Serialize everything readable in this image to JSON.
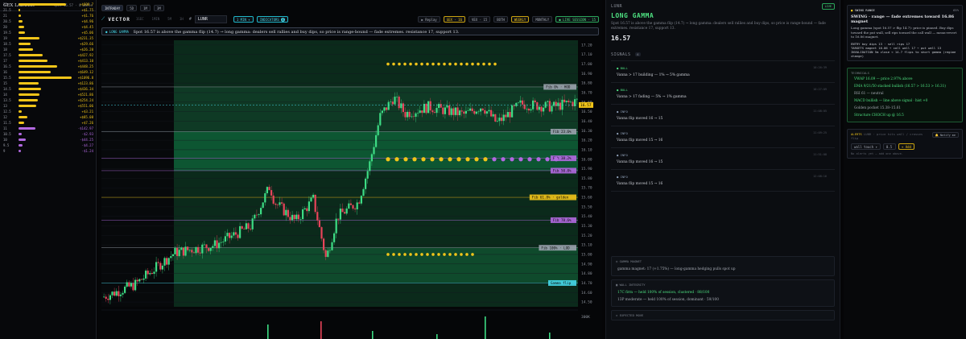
{
  "gex": {
    "title": "GEX LADDER",
    "subtitle": "spot 16.57 · 0 walls",
    "rows": [
      {
        "strike": "22",
        "value": "+$800.7",
        "frac": 0.9,
        "color": "#f0c419"
      },
      {
        "strike": "21.5",
        "value": "+$1.75",
        "frac": 0.03,
        "color": "#f0c419"
      },
      {
        "strike": "21",
        "value": "+$1.76",
        "frac": 0.05,
        "color": "#f0c419"
      },
      {
        "strike": "20.5",
        "value": "+$4.96",
        "frac": 0.08,
        "color": "#f0c419"
      },
      {
        "strike": "20",
        "value": "+$4.45",
        "frac": 0.1,
        "color": "#f0c419"
      },
      {
        "strike": "19.5",
        "value": "+$5.06",
        "frac": 0.12,
        "color": "#f0c419"
      },
      {
        "strike": "19",
        "value": "+$231.35",
        "frac": 0.4,
        "color": "#f0c419"
      },
      {
        "strike": "18.5",
        "value": "+$29.66",
        "frac": 0.22,
        "color": "#f0c419"
      },
      {
        "strike": "18",
        "value": "+$26.20",
        "frac": 0.28,
        "color": "#f0c419"
      },
      {
        "strike": "17.5",
        "value": "+$427.92",
        "frac": 0.45,
        "color": "#f0c419"
      },
      {
        "strike": "17",
        "value": "+$413.10",
        "frac": 0.55,
        "color": "#f0c419"
      },
      {
        "strike": "16.5",
        "value": "+$448.25",
        "frac": 0.72,
        "color": "#f0c419"
      },
      {
        "strike": "16",
        "value": "+$649.12",
        "frac": 0.6,
        "color": "#f0c419"
      },
      {
        "strike": "15.5",
        "value": "+$1096.8",
        "frac": 1.0,
        "color": "#f0c419",
        "label": "◆ +$1096.8"
      },
      {
        "strike": "15",
        "value": "+$123.86",
        "frac": 0.38,
        "color": "#f0c419"
      },
      {
        "strike": "14.5",
        "value": "+$436.34",
        "frac": 0.42,
        "color": "#f0c419"
      },
      {
        "strike": "14",
        "value": "+$521.86",
        "frac": 0.4,
        "color": "#f0c419"
      },
      {
        "strike": "13.5",
        "value": "+$254.24",
        "frac": 0.36,
        "color": "#f0c419"
      },
      {
        "strike": "13",
        "value": "+$551.06",
        "frac": 0.34,
        "color": "#f0c419"
      },
      {
        "strike": "12.5",
        "value": "+$3.21",
        "frac": 0.06,
        "color": "#f0c419"
      },
      {
        "strike": "12",
        "value": "+$85.08",
        "frac": 0.16,
        "color": "#f0c419"
      },
      {
        "strike": "11.5",
        "value": "+$7.26",
        "frac": 0.1,
        "color": "#f0c419"
      },
      {
        "strike": "11",
        "value": "-$142.97",
        "frac": 0.32,
        "color": "#b169e0"
      },
      {
        "strike": "10.5",
        "value": "-$2.93",
        "frac": 0.06,
        "color": "#b169e0"
      },
      {
        "strike": "10",
        "value": "-$44.25",
        "frac": 0.14,
        "color": "#b169e0"
      },
      {
        "strike": "9.5",
        "value": "-$4.27",
        "frac": 0.08,
        "color": "#b169e0"
      },
      {
        "strike": "9",
        "value": "-$1.24",
        "frac": 0.05,
        "color": "#b169e0"
      }
    ]
  },
  "toolbar": {
    "tabs": [
      "INTRADAY",
      "5D",
      "1M",
      "3M"
    ],
    "brand": "VECTOR",
    "nav": [
      "1SEC",
      "1MIN",
      "5M",
      "1H"
    ],
    "ticker": "LUNR",
    "interval": "1 MIN",
    "indicators_label": "INDICATORS",
    "indicators_count": "4",
    "replay": "Replay",
    "gex_chip": "GEX · 16",
    "vex_chip": "VEX · 15",
    "both": "BOTH",
    "weekly": "WEEKLY",
    "monthly": "MONTHLY",
    "live": "LIVE SESSION · 15"
  },
  "banner": {
    "tag": "LONG GAMMA",
    "text": "Spot 16.57 is above the gamma flip (14.7) → long gamma: dealers sell rallies and buy dips, so price is range-bound — fade extremes. resistance 17, support 13."
  },
  "axis": {
    "ticks": [
      "17.20",
      "17.10",
      "17.00",
      "16.90",
      "16.80",
      "16.70",
      "16.60",
      "16.50",
      "16.40",
      "16.30",
      "16.20",
      "16.10",
      "16.00",
      "15.90",
      "15.80",
      "15.70",
      "15.60",
      "15.50",
      "15.40",
      "15.30",
      "15.20",
      "15.10",
      "15.00",
      "14.90",
      "14.80",
      "14.70",
      "14.60",
      "14.50"
    ],
    "vol_tick": "300K"
  },
  "levels": [
    {
      "label": "Fib 0% · HOD",
      "price": 16.76,
      "color": "#9aa2ad"
    },
    {
      "label": "Fib 23.6%",
      "price": 16.29,
      "color": "#9aa2ad"
    },
    {
      "label": "Fib 38.2%",
      "price": 16.01,
      "color": "#b169e0"
    },
    {
      "label": "Fib 50.0%",
      "price": 15.88,
      "color": "#b169e0"
    },
    {
      "label": "Fib 61.8% · golden",
      "price": 15.6,
      "color": "#f0c419"
    },
    {
      "label": "Fib 78.6%",
      "price": 15.36,
      "color": "#b169e0"
    },
    {
      "label": "Fib 100% · LOD",
      "price": 15.07,
      "color": "#9aa2ad"
    },
    {
      "label": "Gamma flip",
      "price": 14.7,
      "color": "#46d7e8"
    }
  ],
  "price_tag": "16.57",
  "gamma": {
    "ticker": "LUNR",
    "live": "LIVE",
    "title": "LONG GAMMA",
    "desc": "Spot 16.57 is above the gamma flip (14.7) → long gamma: dealers sell rallies and buy dips, so price is range-bound — fade extremes. resistance 17, support 13.",
    "price": "16.57",
    "signals_label": "SIGNALS",
    "signals_count": "6",
    "signals": [
      {
        "kind": "BULL",
        "text": "Vanna > 17 building — 1% → 5% gamma",
        "ts": "10:26:39",
        "color": "#4ee081"
      },
      {
        "kind": "BULL",
        "text": "Vanna > 17 fading — 5% → 1% gamma",
        "ts": "10:27:09",
        "color": "#4ee081"
      },
      {
        "kind": "INFO",
        "text": "Vanna flip moved 16 → 15",
        "ts": "11:08:05",
        "color": "#8fa0b8"
      },
      {
        "kind": "INFO",
        "text": "Vanna flip moved 15 → 16",
        "ts": "11:09:25",
        "color": "#8fa0b8"
      },
      {
        "kind": "INFO",
        "text": "Vanna flip moved 16 → 15",
        "ts": "11:51:08",
        "color": "#8fa0b8"
      },
      {
        "kind": "INFO",
        "text": "Vanna flip moved 15 → 16",
        "ts": "12:08:16",
        "color": "#8fa0b8"
      }
    ],
    "magnet_title": "GAMMA MAGNET",
    "magnet_text": "gamma magnet: 17 (+1.75%) — long-gamma hedging pulls spot up",
    "wall_title": "WALL INTEGRITY",
    "walls": [
      {
        "text": "17C firm — held 100% of session, clustered · 88/100",
        "color": "#4ee081"
      },
      {
        "text": "13P moderate — held 100% of session, dominant · 59/100",
        "color": "#a4a9b2"
      }
    ],
    "expected_title": "EXPECTED MOVE"
  },
  "swing": {
    "title": "SWING RANGE",
    "pct": "65%",
    "headline": "SWING · range — fade extremes toward 16.86 magnet",
    "body": "Long gamma (spot 16.57 > flip 14.7): price is pinned. Buy dips toward the put wall, sell rips toward the call wall — mean-revert to 16.86 magnet.",
    "lines": [
      "ENTRY  buy dips 13 · sell rips 17",
      "TARGETS  magnet 16.86 → call wall 17 → put wall 13",
      "INVALIDATION  5m close < 14.7 flips to short gamma (regime change)"
    ]
  },
  "technicals": {
    "title": "TECHNICALS",
    "items": [
      {
        "text": "VWAP 16.09 — price 2.97% above",
        "color": "#4ee081"
      },
      {
        "text": "EMA 9/21/50 stacked bullish (16.57 > 16.53 > 16.31)",
        "color": "#4ee081"
      },
      {
        "text": "RSI 61 — neutral",
        "color": "#a4a9b2"
      },
      {
        "text": "MACD bullish — line above signal · hist +0",
        "color": "#4ee081"
      },
      {
        "text": "Golden pocket 15.38–15.61",
        "color": "#a4a9b2"
      },
      {
        "text": "Structure CHOCH up @ 16.5",
        "color": "#4ee081"
      }
    ]
  },
  "alerts": {
    "title": "ALERTS",
    "subtitle": "LUNR · price hits wall / crosses flip",
    "notify": "Notify me",
    "select": "wall touch",
    "qty": "0.5",
    "add": "+ Add",
    "empty": "No alerts yet — add one above."
  },
  "chart_data": {
    "type": "candlestick",
    "ylim": [
      14.45,
      17.25
    ],
    "levels": [
      16.76,
      16.29,
      16.01,
      15.88,
      15.6,
      15.36,
      15.07,
      14.7
    ],
    "magnet_rows": [
      17.0,
      16.0,
      15.0
    ]
  }
}
